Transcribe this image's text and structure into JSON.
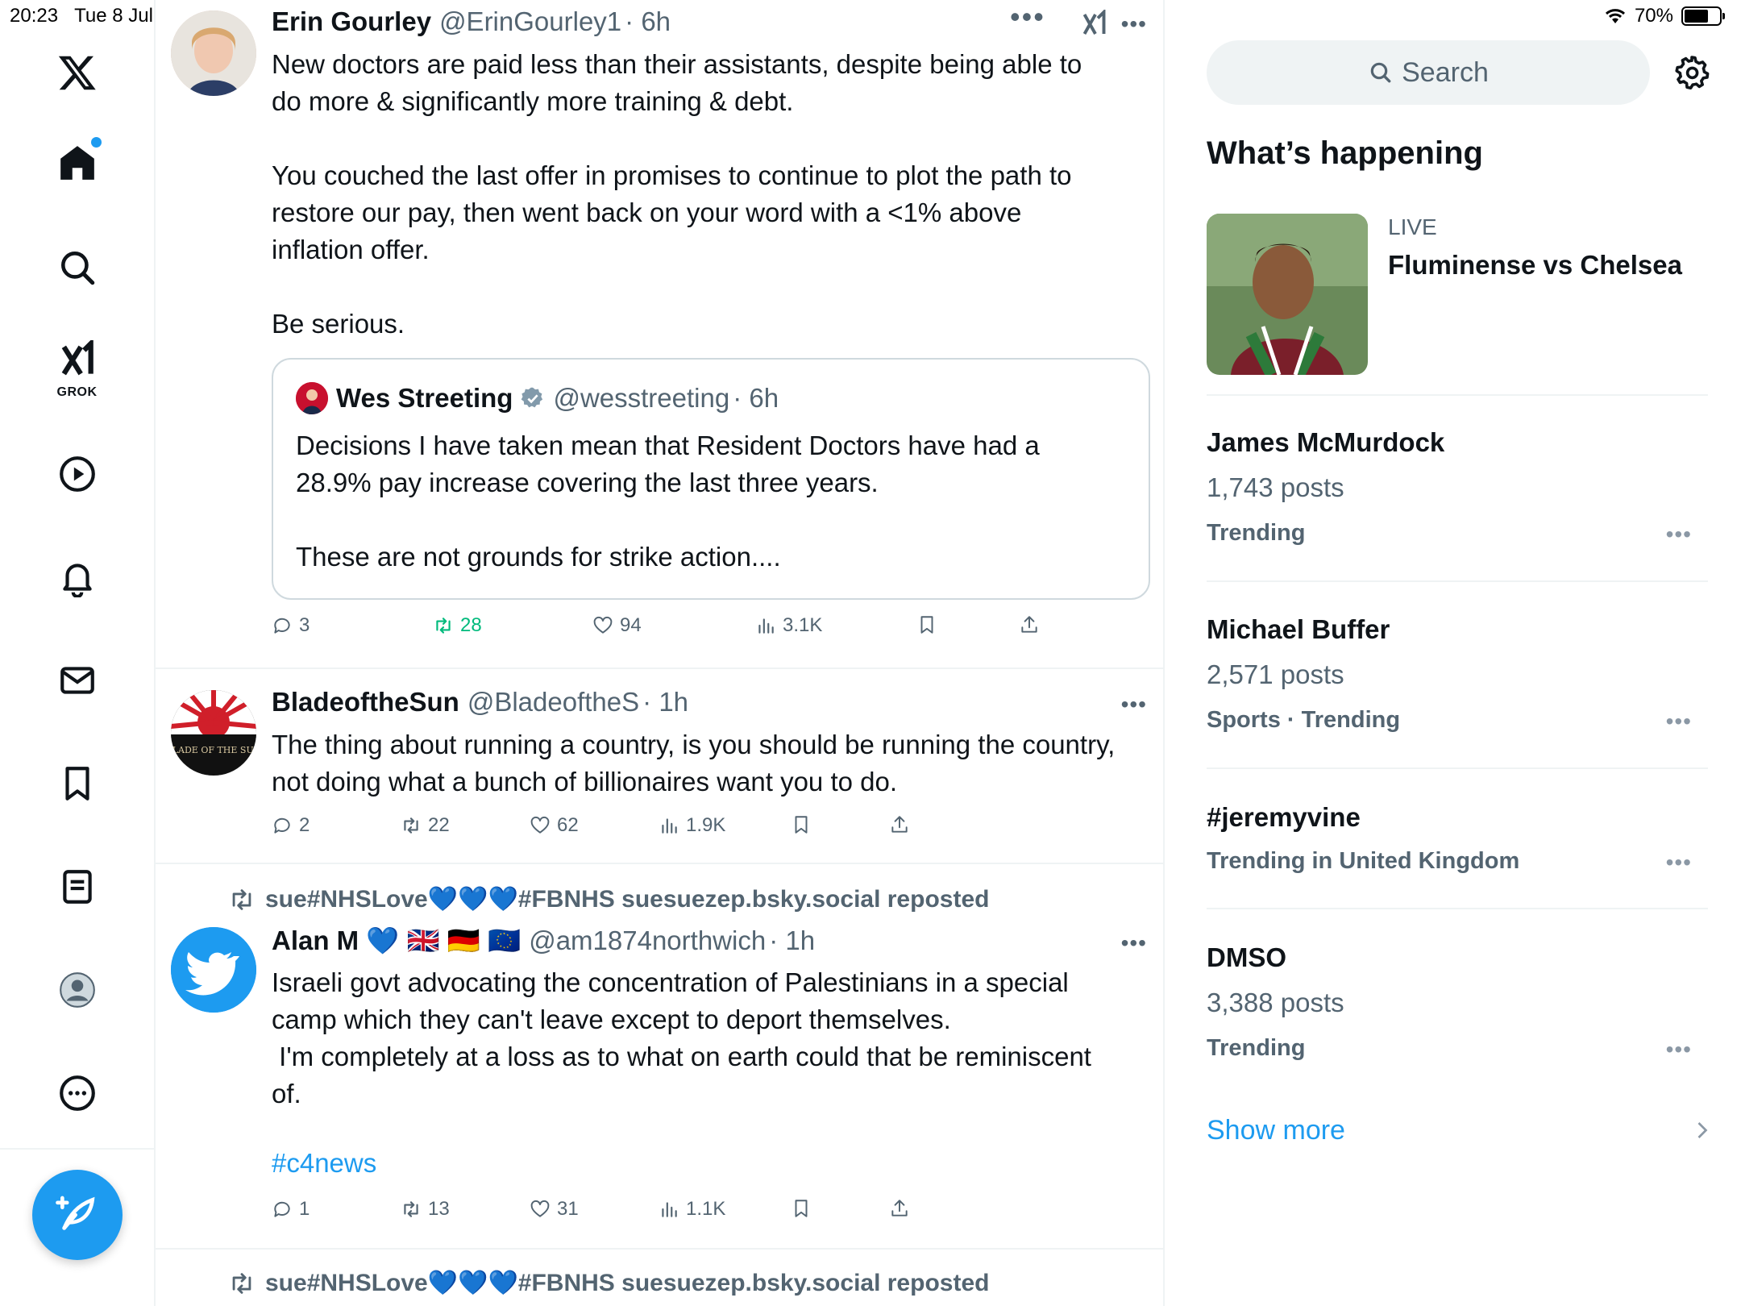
{
  "status_bar": {
    "time": "20:23",
    "date": "Tue 8 Jul",
    "battery": "70%",
    "battery_level": 0.7
  },
  "nav": {
    "items": [
      "x-logo",
      "home",
      "explore",
      "grok",
      "video",
      "notifications",
      "messages",
      "bookmarks",
      "lists",
      "profile",
      "more"
    ],
    "grok_label": "GROK"
  },
  "timeline": {
    "top_more": "•••",
    "tweets": [
      {
        "name": "Erin Gourley",
        "handle": "@ErinGourley1",
        "time": "· 6h",
        "text": "New doctors are paid less than their assistants, despite being able to\ndo more & significantly more training & debt.\n\nYou couched the last offer in promises to continue to plot the path to\nrestore our pay, then went back on your word with a <1% above\ninflation offer.\n\nBe serious.",
        "quote": {
          "name": "Wes Streeting",
          "handle": "@wesstreeting",
          "time": "· 6h",
          "text": "Decisions I have taken mean that Resident Doctors have had a\n28.9% pay increase covering the last three years.\n\nThese are not grounds for strike action...."
        },
        "replies": "3",
        "reposts": "28",
        "likes": "94",
        "views": "3.1K"
      },
      {
        "name": "BladeoftheSun",
        "handle": "@BladeoftheS",
        "time": "· 1h",
        "avatar_text": "BLADE OF THE SUN",
        "text": "The thing about running a country, is you should be running the country,\nnot doing what a bunch of billionaires want you to do.",
        "replies": "2",
        "reposts": "22",
        "likes": "62",
        "views": "1.9K"
      },
      {
        "repost_by": "sue#NHSLove💙💙💙#FBNHS suesuezep.bsky.social reposted",
        "name": "Alan M 💙 🇬🇧 🇩🇪 🇪🇺",
        "handle": "@am1874northwich",
        "time": "· 1h",
        "text": "Israeli govt advocating the concentration of Palestinians in a special\ncamp which they can't leave except to deport themselves.\n I'm completely at a loss as to what on earth could that be reminiscent\nof.",
        "hashtag": "#c4news",
        "replies": "1",
        "reposts": "13",
        "likes": "31",
        "views": "1.1K"
      },
      {
        "repost_by": "sue#NHSLove💙💙💙#FBNHS suesuezep.bsky.social reposted"
      }
    ],
    "more": "•••"
  },
  "sidebar": {
    "search_placeholder": "Search",
    "title": "What’s happening",
    "live": {
      "label": "LIVE",
      "title": "Fluminense vs Chelsea"
    },
    "trends": [
      {
        "name": "James McMurdock",
        "posts": "1,743 posts",
        "meta": "Trending"
      },
      {
        "name": "Michael Buffer",
        "posts": "2,571 posts",
        "meta": "Sports · Trending"
      },
      {
        "name": "#jeremyvine",
        "posts": "",
        "meta": "Trending in United Kingdom"
      },
      {
        "name": "DMSO",
        "posts": "3,388 posts",
        "meta": "Trending"
      }
    ],
    "trend_more": "•••",
    "show_more": "Show more"
  },
  "colors": {
    "accent": "#1d9bf0",
    "repost_green": "#00ba7c",
    "secondary_text": "#536471"
  }
}
